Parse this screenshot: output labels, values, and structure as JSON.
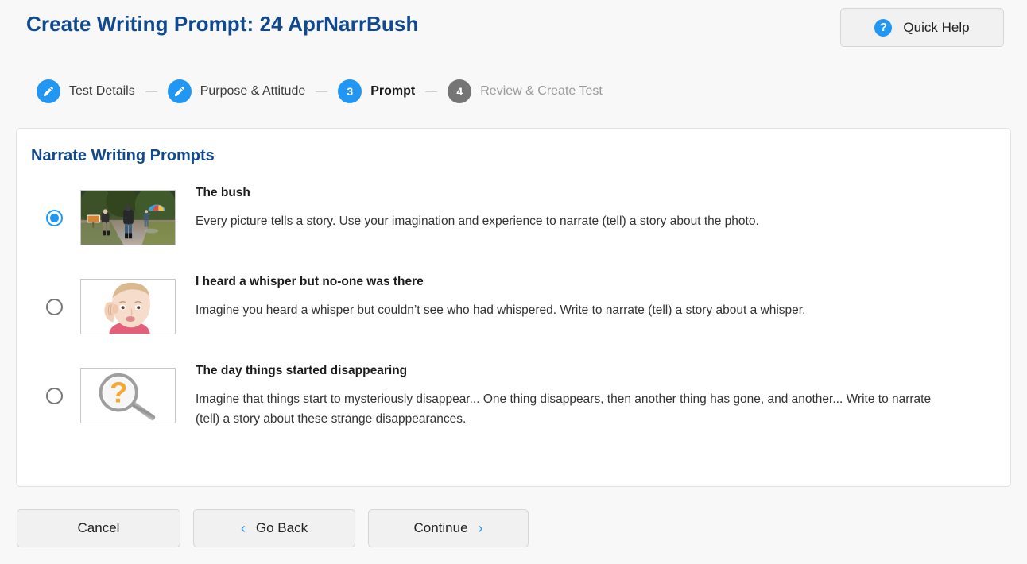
{
  "header": {
    "title": "Create Writing Prompt: 24 AprNarrBush",
    "quick_help_label": "Quick Help",
    "help_icon": "question-circle-icon",
    "accent_blue": "#2196f3",
    "title_color": "#11498f"
  },
  "stepper": {
    "steps": [
      {
        "label": "Test Details",
        "marker": "pencil-icon",
        "state": "done"
      },
      {
        "label": "Purpose & Attitude",
        "marker": "pencil-icon",
        "state": "done"
      },
      {
        "label": "Prompt",
        "marker": "3",
        "state": "active"
      },
      {
        "label": "Review & Create Test",
        "marker": "4",
        "state": "todo"
      }
    ]
  },
  "card": {
    "title": "Narrate Writing Prompts",
    "options": [
      {
        "selected": true,
        "thumbnail": "hikers-on-forest-trail-photo",
        "title": "The bush",
        "description": "Every picture tells a story. Use your imagination and experience to narrate (tell) a story about the photo."
      },
      {
        "selected": false,
        "thumbnail": "girl-listening-cupping-ear-photo",
        "title": "I heard a whisper but no-one was there",
        "description": "Imagine you heard a whisper but couldn’t see who had whispered. Write to narrate (tell) a story about a whisper."
      },
      {
        "selected": false,
        "thumbnail": "magnifying-glass-question-mark-icon",
        "title": "The day things started disappearing",
        "description": "Imagine that things start to mysteriously disappear... One thing disappears, then another thing has gone, and another... Write to narrate (tell) a story about these strange disappearances."
      }
    ]
  },
  "footer": {
    "cancel_label": "Cancel",
    "back_label": "Go Back",
    "continue_label": "Continue",
    "back_chevron": "‹",
    "continue_chevron": "›"
  }
}
